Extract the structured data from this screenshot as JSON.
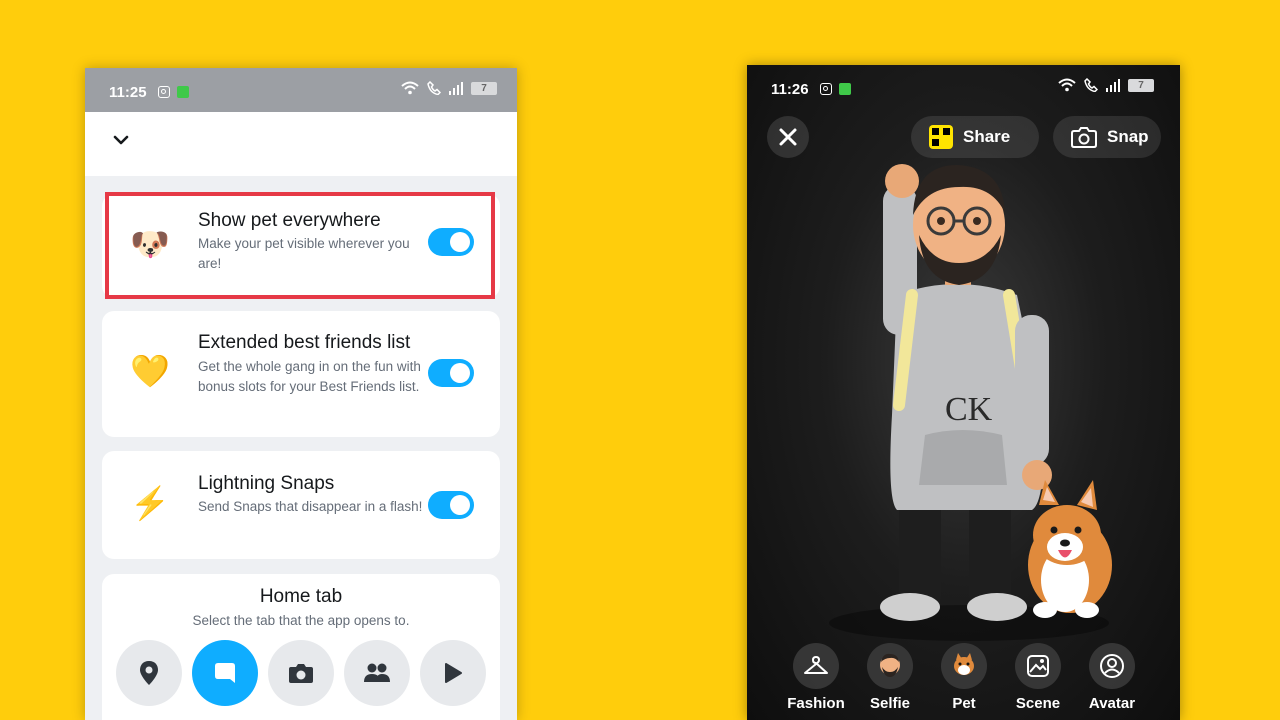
{
  "left_screen": {
    "status_bar": {
      "time": "11:25",
      "battery": "7"
    },
    "settings": [
      {
        "icon": "corgi-icon",
        "emoji": "🐶",
        "title": "Show pet everywhere",
        "description": "Make your pet visible wherever you are!",
        "enabled": true
      },
      {
        "icon": "yellow-heart-icon",
        "emoji": "💛",
        "title": "Extended best friends list",
        "description": "Get the whole gang in on the fun with bonus slots for your Best Friends list.",
        "enabled": true
      },
      {
        "icon": "lightning-icon",
        "emoji": "⚡",
        "title": "Lightning Snaps",
        "description": "Send Snaps that disappear in a flash!",
        "enabled": true
      }
    ],
    "home_tab": {
      "title": "Home tab",
      "subtitle": "Select the tab that the app opens to.",
      "options": [
        "map",
        "chat",
        "camera",
        "stories",
        "spotlight"
      ],
      "selected": "chat"
    }
  },
  "right_screen": {
    "status_bar": {
      "time": "11:26",
      "battery": "7"
    },
    "top_bar": {
      "share_label": "Share",
      "snap_label": "Snap"
    },
    "bottom_nav": [
      {
        "label": "Fashion",
        "icon": "hanger-icon"
      },
      {
        "label": "Selfie",
        "icon": "selfie-avatar-icon"
      },
      {
        "label": "Pet",
        "icon": "pet-corgi-icon"
      },
      {
        "label": "Scene",
        "icon": "scene-image-icon"
      },
      {
        "label": "Avatar",
        "icon": "avatar-settings-icon"
      }
    ]
  },
  "colors": {
    "background": "#FFCD0C",
    "toggle_on": "#0FADFF",
    "highlight_border": "#E63946"
  }
}
